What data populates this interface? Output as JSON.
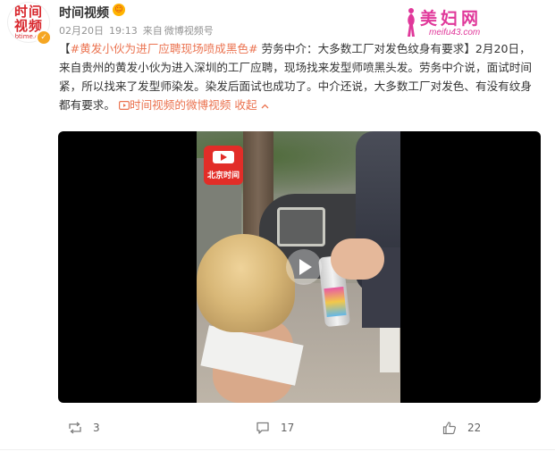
{
  "header": {
    "avatar_logo": "时间\n视频",
    "avatar_domain": "btime.cn",
    "username": "时间视频",
    "date": "02月20日",
    "time": "19:13",
    "source_prefix": "来自",
    "source": "微博视频号"
  },
  "watermark": {
    "title": "美妇网",
    "url": "meifu43.com"
  },
  "post": {
    "open_bracket": "【",
    "hashtag": "#黄发小伙为进厂应聘现场喷成黑色#",
    "headline": " 劳务中介：大多数工厂对发色纹身有要求",
    "close_bracket": "】",
    "body": "2月20日，来自贵州的黄发小伙为进入深圳的工厂应聘，现场找来发型师喷黑头发。劳务中介说，面试时间紧，所以找来了发型师染发。染发后面试也成功了。中介还说，大多数工厂对发色、有没有纹身都有要求。",
    "video_link": "时间视频的微博视频",
    "collapse": "收起"
  },
  "video": {
    "channel_logo_text": "北京时间"
  },
  "actions": {
    "repost_count": "3",
    "comment_count": "17",
    "like_count": "22"
  },
  "colors": {
    "accent": "#eb7350",
    "brand_red": "#d8262c",
    "watermark_pink": "#e0389a"
  }
}
